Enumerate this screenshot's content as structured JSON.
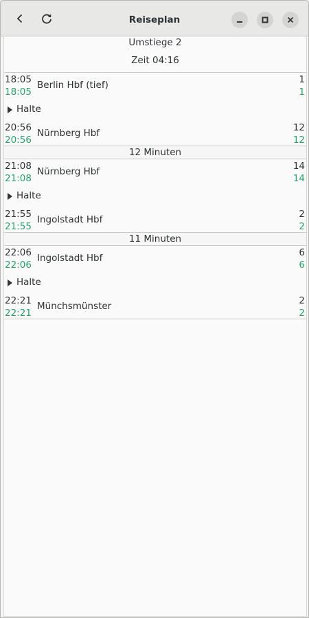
{
  "header": {
    "title": "Reiseplan",
    "back_icon": "back-arrow-icon",
    "refresh_icon": "refresh-icon"
  },
  "window_controls": {
    "minimize": "minimize-icon",
    "maximize": "maximize-icon",
    "close": "close-icon"
  },
  "summary": {
    "transfers": "Umstiege 2",
    "duration": "Zeit 04:16"
  },
  "colors": {
    "realtime": "#26a269",
    "text": "#2e3436",
    "header": "#e8e8e7"
  },
  "legs": [
    {
      "dep": {
        "planned": "18:05",
        "actual": "18:05",
        "station": "Berlin Hbf (tief)",
        "platform": "1",
        "platform_actual": "1"
      },
      "stops_label": "Halte",
      "arr": {
        "planned": "20:56",
        "actual": "20:56",
        "station": "Nürnberg Hbf",
        "platform": "12",
        "platform_actual": "12"
      }
    },
    {
      "dep": {
        "planned": "21:08",
        "actual": "21:08",
        "station": "Nürnberg Hbf",
        "platform": "14",
        "platform_actual": "14"
      },
      "stops_label": "Halte",
      "arr": {
        "planned": "21:55",
        "actual": "21:55",
        "station": "Ingolstadt Hbf",
        "platform": "2",
        "platform_actual": "2"
      }
    },
    {
      "dep": {
        "planned": "22:06",
        "actual": "22:06",
        "station": "Ingolstadt Hbf",
        "platform": "6",
        "platform_actual": "6"
      },
      "stops_label": "Halte",
      "arr": {
        "planned": "22:21",
        "actual": "22:21",
        "station": "Münchsmünster",
        "platform": "2",
        "platform_actual": "2"
      }
    }
  ],
  "transfers": [
    "12 Minuten",
    "11 Minuten"
  ]
}
